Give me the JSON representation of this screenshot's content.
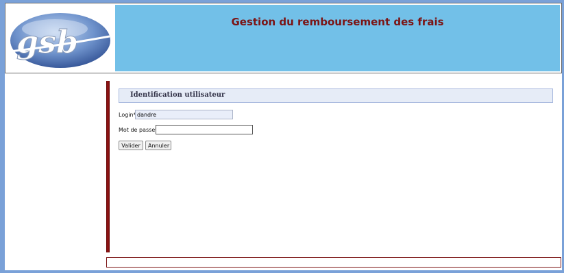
{
  "header": {
    "logo_text": "gsb",
    "title": "Gestion du remboursement des frais"
  },
  "login_form": {
    "title": "Identification utilisateur",
    "login_label": "Login*",
    "login_value": "dandre",
    "password_label": "Mot de passe*",
    "password_value": "",
    "validate_label": "Valider",
    "cancel_label": "Annuler"
  },
  "colors": {
    "page_background": "#7aa1d8",
    "header_background": "#72c0e8",
    "title_color": "#7b1414",
    "accent_bar": "#8b0f0f"
  }
}
